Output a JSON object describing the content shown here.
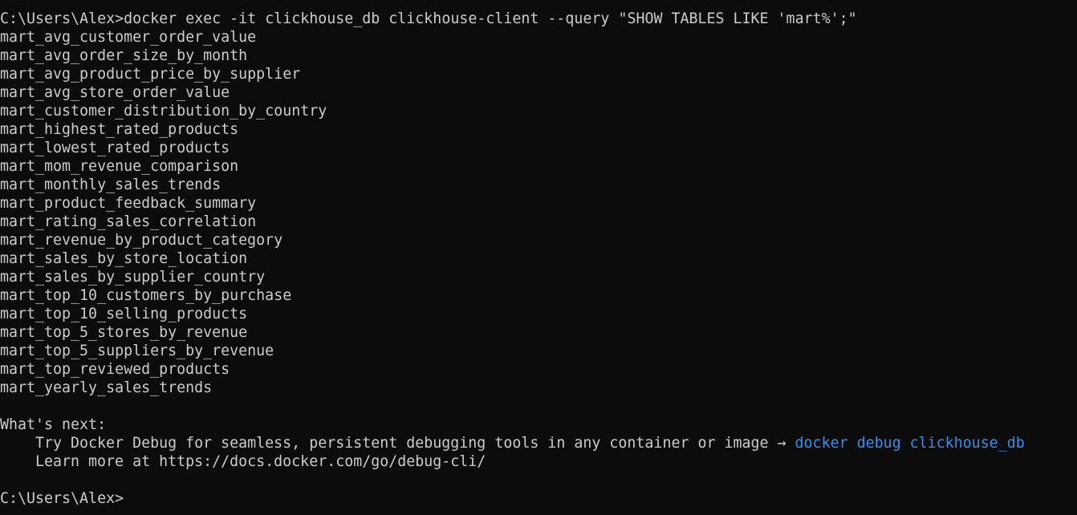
{
  "terminal": {
    "command": {
      "prompt": "C:\\Users\\Alex>",
      "text": "docker exec -it clickhouse_db clickhouse-client --query \"SHOW TABLES LIKE 'mart%';\""
    },
    "tables": [
      "mart_avg_customer_order_value",
      "mart_avg_order_size_by_month",
      "mart_avg_product_price_by_supplier",
      "mart_avg_store_order_value",
      "mart_customer_distribution_by_country",
      "mart_highest_rated_products",
      "mart_lowest_rated_products",
      "mart_mom_revenue_comparison",
      "mart_monthly_sales_trends",
      "mart_product_feedback_summary",
      "mart_rating_sales_correlation",
      "mart_revenue_by_product_category",
      "mart_sales_by_store_location",
      "mart_sales_by_supplier_country",
      "mart_top_10_customers_by_purchase",
      "mart_top_10_selling_products",
      "mart_top_5_stores_by_revenue",
      "mart_top_5_suppliers_by_revenue",
      "mart_top_reviewed_products",
      "mart_yearly_sales_trends"
    ],
    "whats_next": {
      "heading": "What's next:",
      "debug_text": "Try Docker Debug for seamless, persistent debugging tools in any container or image → ",
      "debug_command": "docker debug clickhouse_db",
      "learn_more": "Learn more at https://docs.docker.com/go/debug-cli/"
    },
    "final_prompt": "C:\\Users\\Alex>",
    "colors": {
      "background": "#0c0c0c",
      "foreground": "#cccccc",
      "link": "#3b8eea"
    }
  }
}
